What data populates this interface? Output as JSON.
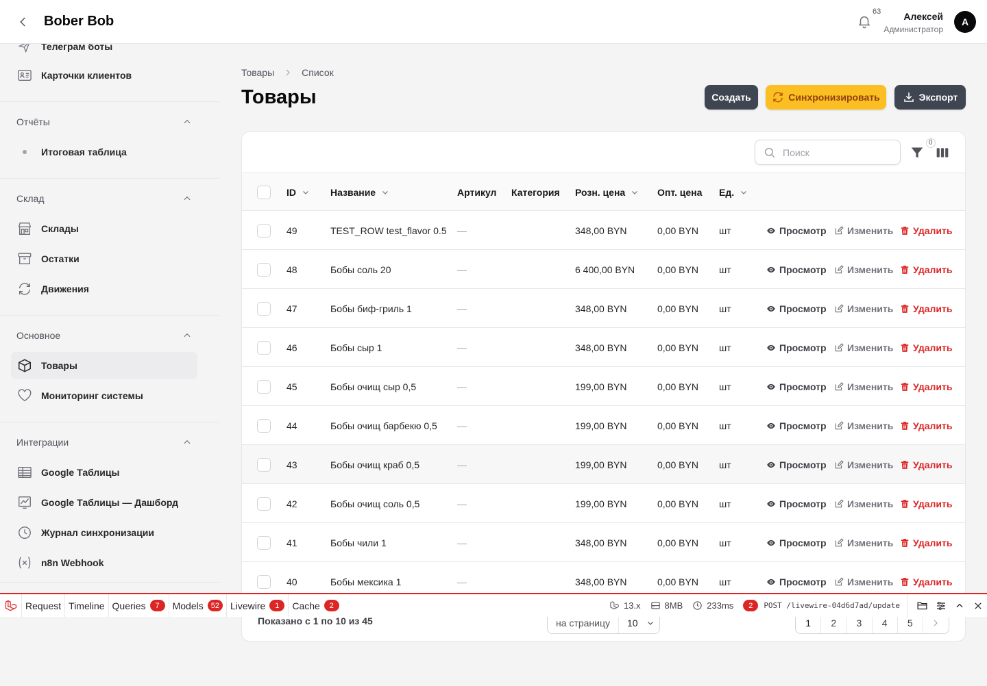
{
  "header": {
    "brand": "Bober Bob",
    "notifications_count": "63",
    "user_name": "Алексей",
    "user_role": "Администратор",
    "avatar_letter": "А"
  },
  "sidebar": {
    "items_top": [
      {
        "label": "Телеграм боты",
        "icon": "send-icon"
      },
      {
        "label": "Карточки клиентов",
        "icon": "id-card-icon"
      }
    ],
    "groups": [
      {
        "label": "Отчёты",
        "items": [
          {
            "label": "Итоговая таблица",
            "icon": "dot-icon"
          }
        ]
      },
      {
        "label": "Склад",
        "items": [
          {
            "label": "Склады",
            "icon": "building-storefront-icon"
          },
          {
            "label": "Остатки",
            "icon": "archive-box-icon"
          },
          {
            "label": "Движения",
            "icon": "arrows-refresh-icon"
          }
        ]
      },
      {
        "label": "Основное",
        "items": [
          {
            "label": "Товары",
            "icon": "cube-icon",
            "active": true
          },
          {
            "label": "Мониторинг системы",
            "icon": "heart-icon"
          }
        ]
      },
      {
        "label": "Интеграции",
        "items": [
          {
            "label": "Google Таблицы",
            "icon": "table-icon"
          },
          {
            "label": "Google Таблицы — Дашборд",
            "icon": "chart-icon"
          },
          {
            "label": "Журнал синхронизации",
            "icon": "clock-icon"
          },
          {
            "label": "n8n Webhook",
            "icon": "variable-icon"
          }
        ]
      }
    ]
  },
  "breadcrumb": {
    "first": "Товары",
    "second": "Список"
  },
  "page_title": "Товары",
  "actions": {
    "create": "Создать",
    "sync": "Синхронизировать",
    "export": "Экспорт"
  },
  "table": {
    "search_placeholder": "Поиск",
    "filter_count": "0",
    "columns": [
      "ID",
      "Название",
      "Артикул",
      "Категория",
      "Розн. цена",
      "Опт. цена",
      "Ед."
    ],
    "action_labels": {
      "view": "Просмотр",
      "edit": "Изменить",
      "delete": "Удалить"
    },
    "rows": [
      {
        "id": "49",
        "name": "TEST_ROW test_flavor 0.5",
        "sku": "—",
        "category": "",
        "retail": "348,00 BYN",
        "wholesale": "0,00 BYN",
        "unit": "шт"
      },
      {
        "id": "48",
        "name": "Бобы соль 20",
        "sku": "—",
        "category": "",
        "retail": "6 400,00 BYN",
        "wholesale": "0,00 BYN",
        "unit": "шт"
      },
      {
        "id": "47",
        "name": "Бобы биф-гриль 1",
        "sku": "—",
        "category": "",
        "retail": "348,00 BYN",
        "wholesale": "0,00 BYN",
        "unit": "шт"
      },
      {
        "id": "46",
        "name": "Бобы сыр 1",
        "sku": "—",
        "category": "",
        "retail": "348,00 BYN",
        "wholesale": "0,00 BYN",
        "unit": "шт"
      },
      {
        "id": "45",
        "name": "Бобы очищ сыр 0,5",
        "sku": "—",
        "category": "",
        "retail": "199,00 BYN",
        "wholesale": "0,00 BYN",
        "unit": "шт"
      },
      {
        "id": "44",
        "name": "Бобы очищ барбекю 0,5",
        "sku": "—",
        "category": "",
        "retail": "199,00 BYN",
        "wholesale": "0,00 BYN",
        "unit": "шт"
      },
      {
        "id": "43",
        "name": "Бобы очищ краб 0,5",
        "sku": "—",
        "category": "",
        "retail": "199,00 BYN",
        "wholesale": "0,00 BYN",
        "unit": "шт"
      },
      {
        "id": "42",
        "name": "Бобы очищ соль 0,5",
        "sku": "—",
        "category": "",
        "retail": "199,00 BYN",
        "wholesale": "0,00 BYN",
        "unit": "шт"
      },
      {
        "id": "41",
        "name": "Бобы чили 1",
        "sku": "—",
        "category": "",
        "retail": "348,00 BYN",
        "wholesale": "0,00 BYN",
        "unit": "шт"
      },
      {
        "id": "40",
        "name": "Бобы мексика 1",
        "sku": "—",
        "category": "",
        "retail": "348,00 BYN",
        "wholesale": "0,00 BYN",
        "unit": "шт"
      }
    ]
  },
  "pagination": {
    "summary": "Показано с 1 по 10 из 45",
    "per_page_label": "на страницу",
    "per_page_value": "10",
    "pages": [
      "1",
      "2",
      "3",
      "4",
      "5"
    ],
    "current_page": "1"
  },
  "debugbar": {
    "tabs": [
      {
        "label": "Request",
        "badge": ""
      },
      {
        "label": "Timeline",
        "badge": ""
      },
      {
        "label": "Queries",
        "badge": "7"
      },
      {
        "label": "Models",
        "badge": "52"
      },
      {
        "label": "Livewire",
        "badge": "1"
      },
      {
        "label": "Cache",
        "badge": "2"
      }
    ],
    "version": "13.x",
    "memory": "8MB",
    "time": "233ms",
    "request_count": "2",
    "request": "POST /livewire-04d6d7ad/update"
  },
  "colors": {
    "accent": "#fbbf24",
    "danger": "#dc2626",
    "dark_button": "#3f4652"
  }
}
